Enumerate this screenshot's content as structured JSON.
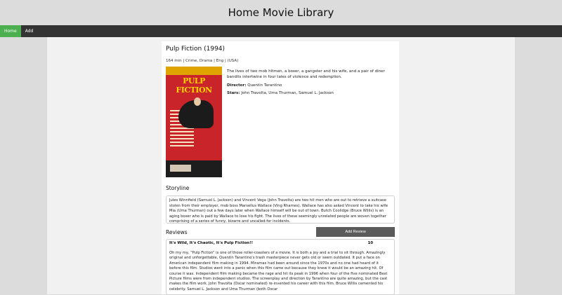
{
  "site": {
    "title": "Home Movie Library"
  },
  "nav": {
    "items": [
      {
        "label": "Home"
      },
      {
        "label": "Add"
      }
    ]
  },
  "movie": {
    "title": "Pulp Fiction (1994)",
    "meta": "164 min | Crime, Drama | Eng | (USA)",
    "plot": "The lives of two mob hitmen, a boxer, a gangster and his wife, and a pair of diner bandits intertwine in four tales of violence and redemption.",
    "director_label": "Director:",
    "director": "Quentin Tarantino",
    "stars_label": "Stars:",
    "stars": "John Travolta, Uma Thurman, Samuel L. Jackson",
    "poster_title": "PULP FICTION"
  },
  "storyline": {
    "heading": "Storyline",
    "text": "Jules Winnfield (Samuel L. Jackson) and Vincent Vega (John Travolta) are two hit men who are out to retrieve a suitcase stolen from their employer, mob boss Marsellus Wallace (Ving Rhames). Wallace has also asked Vincent to take his wife Mia (Uma Thurman) out a few days later when Wallace himself will be out of town. Butch Coolidge (Bruce Willis) is an aging boxer who is paid by Wallace to lose his fight. The lives of these seemingly unrelated people are woven together comprising of a series of funny, bizarre and uncalled-for incidents."
  },
  "reviews": {
    "heading": "Reviews",
    "add_button": "Add Review",
    "items": [
      {
        "title": "It's Wild, It's Chaotic, It's Pulp Fiction!!",
        "rating": "10",
        "body": "Oh my my, \"Pulp Fiction\" is one of those roller-coasters of a movie. It is both a joy and a trial to sit through. Amazingly original and unforgettable, Quentin Tarantino's trash masterpiece never gets old or seem outdated. It put a face on American independent film making in 1994. Miramax had been around since the 1970s and no one had heard of it before this film. Studios went into a panic when this film came out because they knew it would be an amazing hit. Of course it was. Independent film making became the rage and hit its peak in 1996 when four of the five nominated Best Picture films were from independent studios. The screenplay and direction by Tarantino are quite amazing, but the cast makes the film work. John Travolta (Oscar nominated) re-invented his career with this film. Bruce Willis cemented his celebrity. Samuel L. Jackson and Uma Thurman (both Oscar"
      }
    ]
  }
}
